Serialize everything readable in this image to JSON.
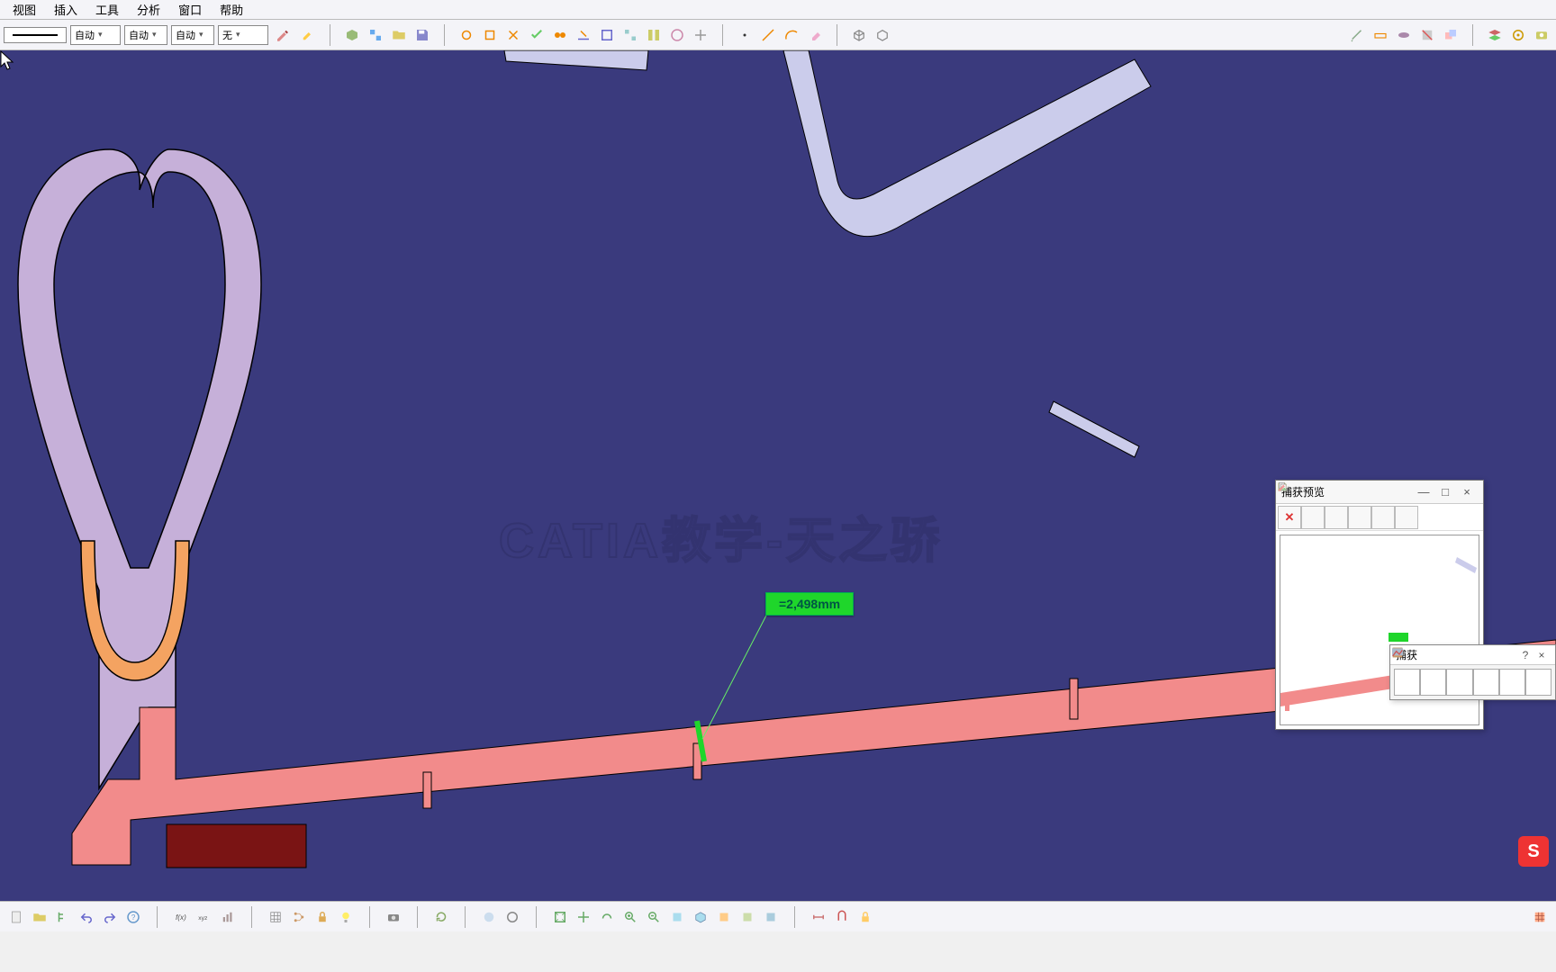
{
  "menu": {
    "view": "视图",
    "insert": "插入",
    "tools": "工具",
    "analysis": "分析",
    "window": "窗口",
    "help": "帮助"
  },
  "toolbar": {
    "auto": "自动",
    "auto2": "自动",
    "auto3": "自动",
    "none": "无"
  },
  "measurement": {
    "value": "=2,498mm"
  },
  "watermark": "CATIA教学-天之骄",
  "capture_preview": {
    "title": "捕获预览",
    "minimize": "—",
    "maximize": "□",
    "close": "×"
  },
  "capture_palette": {
    "title": "捕获",
    "help": "?",
    "close": "×"
  },
  "s_badge": "S"
}
